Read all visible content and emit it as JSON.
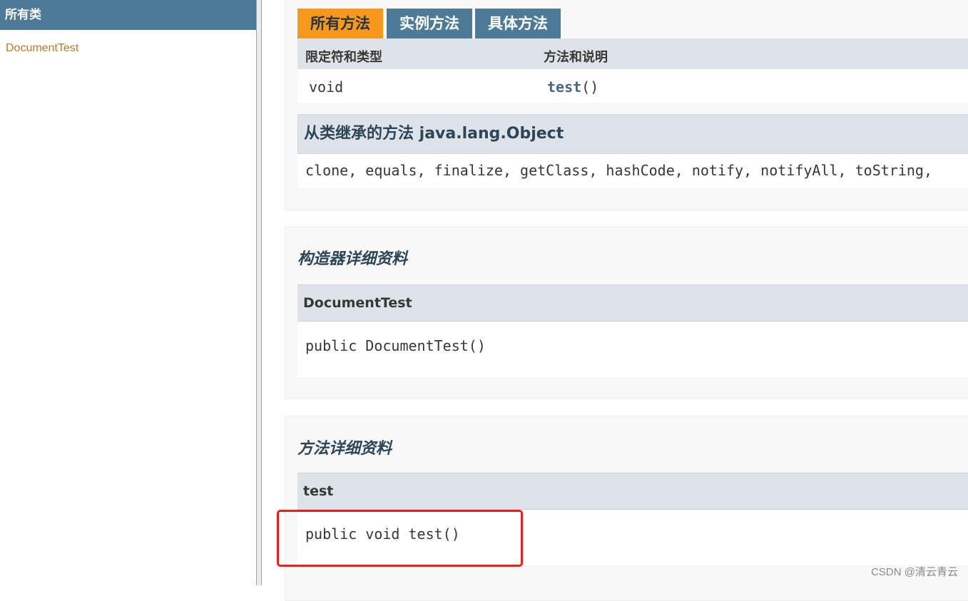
{
  "left_frame": {
    "title": "所有类",
    "classes": [
      "DocumentTest"
    ]
  },
  "method_summary": {
    "tabs": [
      {
        "label": "所有方法",
        "active": true
      },
      {
        "label": "实例方法",
        "active": false
      },
      {
        "label": "具体方法",
        "active": false
      }
    ],
    "columns": [
      "限定符和类型",
      "方法和说明"
    ],
    "rows": [
      {
        "modifier": "void",
        "method": "test",
        "suffix": "()"
      }
    ],
    "inherited_title": "从类继承的方法 java.lang.Object",
    "inherited_methods": "clone, equals, finalize, getClass, hashCode, notify, notifyAll, toString,"
  },
  "constructor_detail": {
    "title": "构造器详细资料",
    "name": "DocumentTest",
    "signature": "public DocumentTest()"
  },
  "method_detail": {
    "title": "方法详细资料",
    "name": "test",
    "signature": "public void test()"
  },
  "watermark": "CSDN @清云青云",
  "colors": {
    "header_blue": "#4d7a97",
    "active_tab": "#f8981d",
    "table_header": "#dee3e9",
    "link_orange": "#bb7a2a",
    "highlight_red": "#e8211c"
  }
}
